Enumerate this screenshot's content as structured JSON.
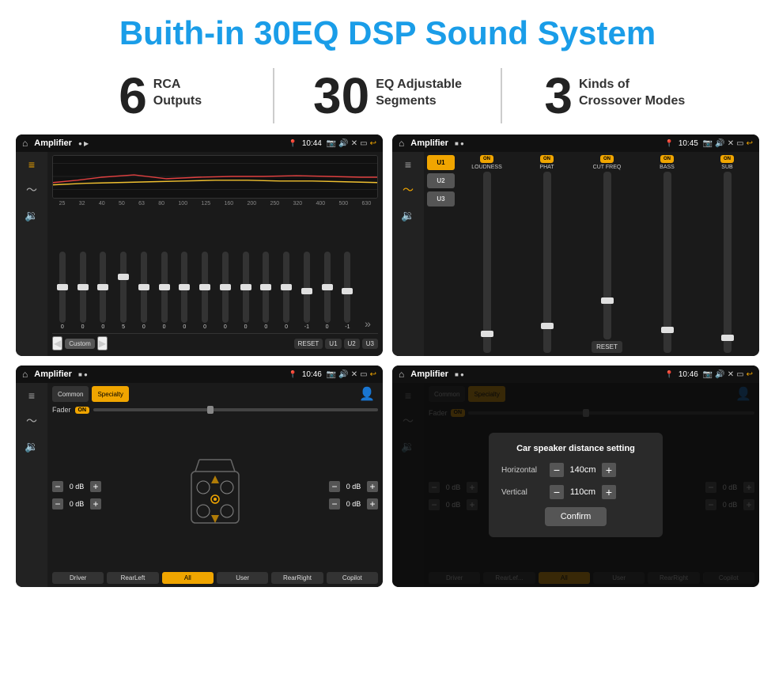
{
  "header": {
    "title": "Buith-in 30EQ DSP Sound System"
  },
  "stats": [
    {
      "number": "6",
      "label": "RCA\nOutputs"
    },
    {
      "number": "30",
      "label": "EQ Adjustable\nSegments"
    },
    {
      "number": "3",
      "label": "Kinds of\nCrossover Modes"
    }
  ],
  "screens": {
    "eq": {
      "title": "Amplifier",
      "time": "10:44",
      "freqs": [
        "25",
        "32",
        "40",
        "50",
        "63",
        "80",
        "100",
        "125",
        "160",
        "200",
        "250",
        "320",
        "400",
        "500",
        "630"
      ],
      "values": [
        "0",
        "0",
        "0",
        "5",
        "0",
        "0",
        "0",
        "0",
        "0",
        "0",
        "0",
        "0",
        "-1",
        "0",
        "-1"
      ],
      "controls": [
        "◀",
        "Custom",
        "▶",
        "RESET",
        "U1",
        "U2",
        "U3"
      ]
    },
    "amplifier": {
      "title": "Amplifier",
      "time": "10:45",
      "presets": [
        "U1",
        "U2",
        "U3"
      ],
      "channels": [
        "LOUDNESS",
        "PHAT",
        "CUT FREQ",
        "BASS",
        "SUB"
      ],
      "reset": "RESET"
    },
    "crossover": {
      "title": "Amplifier",
      "time": "10:46",
      "tabs": [
        "Common",
        "Specialty"
      ],
      "faderLabel": "Fader",
      "faderOn": "ON",
      "channels": {
        "left_top": "0 dB",
        "left_bottom": "0 dB",
        "right_top": "0 dB",
        "right_bottom": "0 dB"
      },
      "buttons": [
        "Driver",
        "RearLeft",
        "All",
        "User",
        "RearRight",
        "Copilot"
      ]
    },
    "dialog": {
      "title": "Amplifier",
      "time": "10:46",
      "tabs": [
        "Common",
        "Specialty"
      ],
      "dialogTitle": "Car speaker distance setting",
      "horizontal": {
        "label": "Horizontal",
        "value": "140cm"
      },
      "vertical": {
        "label": "Vertical",
        "value": "110cm"
      },
      "confirmLabel": "Confirm",
      "rightTopDb": "0 dB",
      "rightBottomDb": "0 dB",
      "buttons": [
        "Driver",
        "RearLef...",
        "All",
        "User",
        "RearRight",
        "Copilot"
      ]
    }
  },
  "colors": {
    "accent": "#f0a500",
    "blue": "#1a9de8",
    "bg_dark": "#1a1a1a",
    "text_light": "#ffffff",
    "text_dim": "#888888"
  }
}
